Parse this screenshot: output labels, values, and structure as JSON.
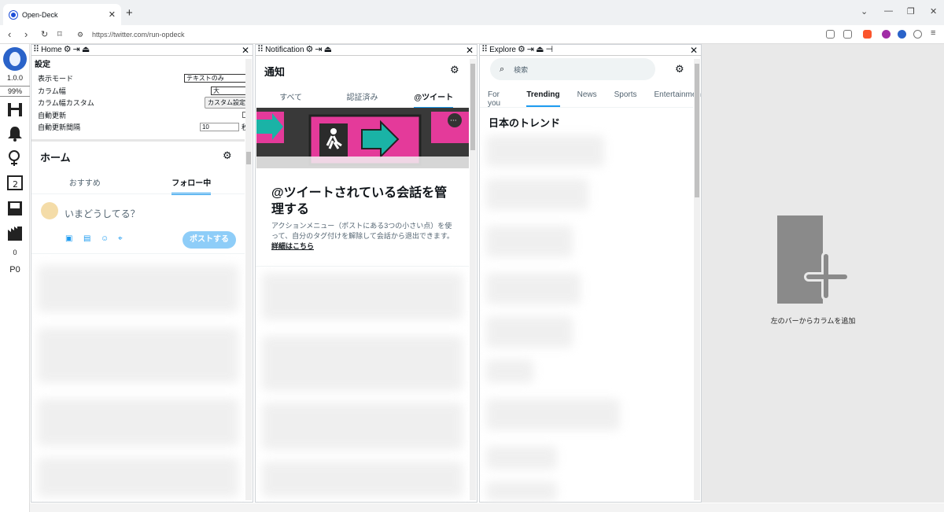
{
  "browser": {
    "tab_title": "Open-Deck",
    "url": "https://twitter.com/run-opdeck"
  },
  "leftbar": {
    "version": "1.0.0",
    "zoom": "99%",
    "count": "0",
    "p": "P0"
  },
  "home_col": {
    "header": "Home",
    "settings": {
      "title": "設定",
      "display_mode_label": "表示モード",
      "display_mode_value": "テキストのみ",
      "width_label": "カラム幅",
      "width_value": "大",
      "custom_width_label": "カラム幅カスタム",
      "custom_button": "カスタム設定",
      "auto_update_label": "自動更新",
      "interval_label": "自動更新間隔",
      "interval_value": "10",
      "interval_unit": "秒"
    },
    "title": "ホーム",
    "tab_recommended": "おすすめ",
    "tab_following": "フォロー中",
    "compose_placeholder": "いまどうしてる？",
    "post_button": "ポストする"
  },
  "notif_col": {
    "header": "Notification",
    "title": "通知",
    "tab_all": "すべて",
    "tab_verified": "認証済み",
    "tab_mentions": "@ツイート",
    "promo_title": "@ツイートされている会話を管理する",
    "promo_body": "アクションメニュー（ポストにある3つの小さい点）を使って、自分のタグ付けを解除して会話から退出できます。",
    "promo_link": "詳細はこちら"
  },
  "explore_col": {
    "header": "Explore",
    "search_placeholder": "検索",
    "tabs": [
      "For you",
      "Trending",
      "News",
      "Sports",
      "Entertainmen"
    ],
    "trend_title": "日本のトレンド"
  },
  "add_column": {
    "label": "左のバーからカラムを追加"
  }
}
